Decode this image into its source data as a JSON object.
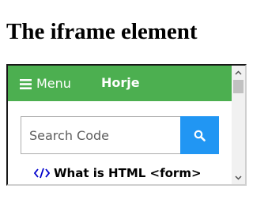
{
  "page": {
    "heading": "The iframe element"
  },
  "iframe": {
    "nav": {
      "menu_label": "Menu",
      "menu_icon": "hamburger-icon",
      "brand": "Horje",
      "background_color": "#4caf50"
    },
    "search": {
      "placeholder": "Search Code",
      "value": "",
      "button_icon": "search-icon",
      "button_color": "#2196f3"
    },
    "link": {
      "icon": "code-icon",
      "icon_color": "#0000cc",
      "label": "What is HTML <form>"
    },
    "scrollbar": {
      "position": 0
    }
  }
}
